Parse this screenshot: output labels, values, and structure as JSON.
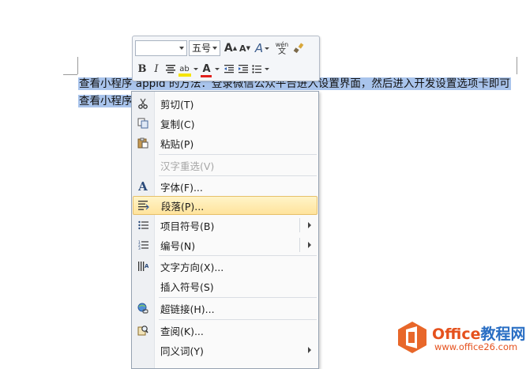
{
  "document": {
    "line1_prefix": "查看小程序 ",
    "line1_rest": "appid 的方法：登录微信公众平台进入设置界面，然后进入开发设置选项卡即可",
    "line2": "查看小程序"
  },
  "minitoolbar": {
    "font_name": "",
    "font_size": "五号",
    "grow_font": "A",
    "shrink_font": "A",
    "styles": "A",
    "wen": "wén",
    "wen_sub": "文",
    "bold": "B",
    "italic": "I",
    "font_color_label": "A",
    "highlight_label": "ab"
  },
  "menu": {
    "cut": "剪切(T)",
    "copy": "复制(C)",
    "paste": "粘贴(P)",
    "reconvert": "汉字重选(V)",
    "font": "字体(F)...",
    "paragraph": "段落(P)...",
    "bullets": "项目符号(B)",
    "numbering": "编号(N)",
    "text_direction": "文字方向(X)...",
    "insert_symbol": "插入符号(S)",
    "hyperlink": "超链接(H)...",
    "lookup": "查阅(K)...",
    "synonyms": "同义词(Y)"
  },
  "watermark": {
    "brand": "Office",
    "brand_tail": "教程网",
    "url": "www.office26.com"
  },
  "colors": {
    "selection": "#a9c4ec",
    "highlight_menu": "#ffe39c",
    "font_color": "#e0201c",
    "highlight_pen": "#f5e400",
    "brand": "#e5511d"
  }
}
